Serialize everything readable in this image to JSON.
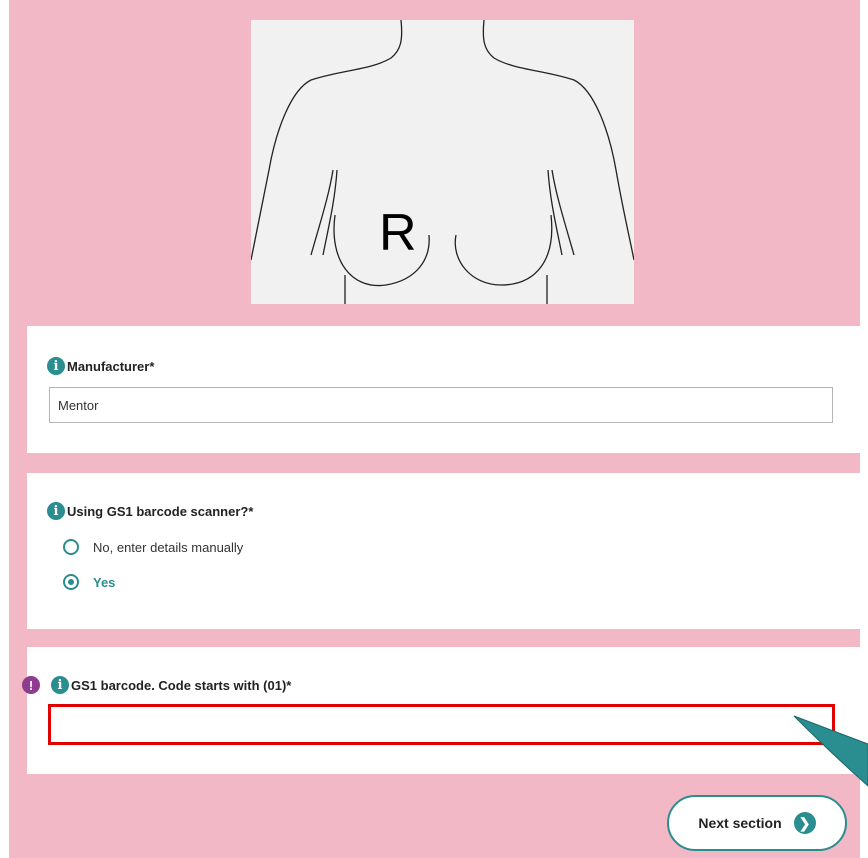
{
  "diagram": {
    "side_label": "R"
  },
  "manufacturer": {
    "label": "Manufacturer*",
    "value": "Mentor"
  },
  "scanner": {
    "label": "Using GS1 barcode scanner?*",
    "options": [
      {
        "label": "No, enter details manually",
        "selected": false
      },
      {
        "label": "Yes",
        "selected": true
      }
    ]
  },
  "barcode": {
    "label": "GS1 barcode. Code starts with (01)*",
    "value": "",
    "error": true
  },
  "next_button": {
    "label": "Next section"
  },
  "icons": {
    "info": "info-icon",
    "warning": "exclamation-icon",
    "next": "chevron-right-icon",
    "pointer": "callout-pointer"
  },
  "colors": {
    "background": "#f2b8c5",
    "accent": "#2a8d8f",
    "error": "#e00000",
    "warning": "#8f3b8f"
  }
}
